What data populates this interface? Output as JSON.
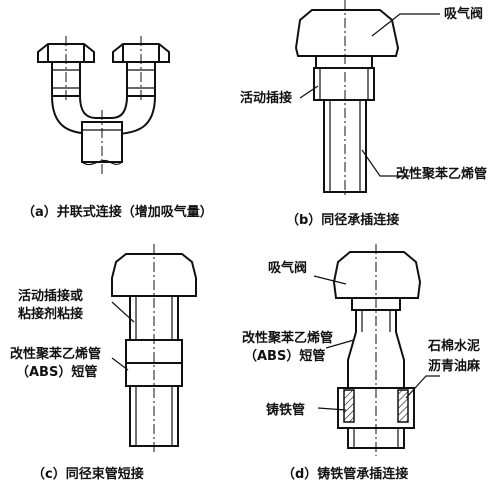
{
  "panels": {
    "a": {
      "caption": "（a）并联式连接（增加吸气量）"
    },
    "b": {
      "caption": "（b）同径承插连接",
      "labels": {
        "valve": "吸气阀",
        "joint": "活动插接",
        "pipe": "改性聚苯乙烯管"
      }
    },
    "c": {
      "caption": "（c）同径束管短接",
      "labels": {
        "joint_line1": "活动插接或",
        "joint_line2": "粘接剂粘接",
        "pipe_line1": "改性聚苯乙烯管",
        "pipe_line2": "（ABS）短管"
      }
    },
    "d": {
      "caption": "（d）铸铁管承插连接",
      "labels": {
        "valve": "吸气阀",
        "pipe_line1": "改性聚苯乙烯管",
        "pipe_line2": "（ABS）短管",
        "seal_line1": "石棉水泥",
        "seal_line2": "沥青油麻",
        "iron": "铸铁管"
      }
    }
  }
}
